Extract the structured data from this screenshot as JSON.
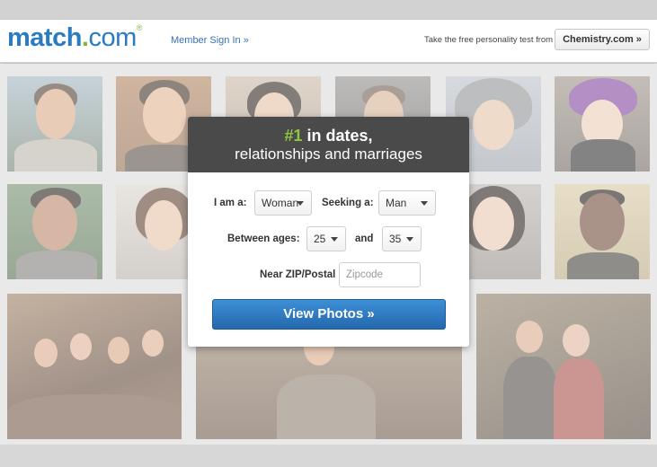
{
  "header": {
    "logo_main": "match",
    "logo_dot": ".",
    "logo_com": "com",
    "logo_reg": "®",
    "member_sign_in": "Member Sign In »",
    "personality_test": "Take the free personality test from",
    "chemistry_button": "Chemistry.com »"
  },
  "panel": {
    "headline_num": "#1",
    "headline_rest": " in dates,",
    "headline_line2": "relationships and marriages",
    "i_am_label": "I am a:",
    "i_am_value": "Woman",
    "seeking_label": "Seeking a:",
    "seeking_value": "Man",
    "ages_label": "Between ages:",
    "age_min": "25",
    "and_label": "and",
    "age_max": "35",
    "zip_label": "Near ZIP/Postal code:",
    "zip_placeholder": "Zipcode",
    "view_button": "View Photos »"
  },
  "colors": {
    "brand_blue": "#2b7bc0",
    "brand_green": "#7fb539",
    "panel_header": "#4a4a4a",
    "button_blue": "#2b72b8"
  },
  "icons": {
    "dropdown": "caret-down-icon"
  }
}
